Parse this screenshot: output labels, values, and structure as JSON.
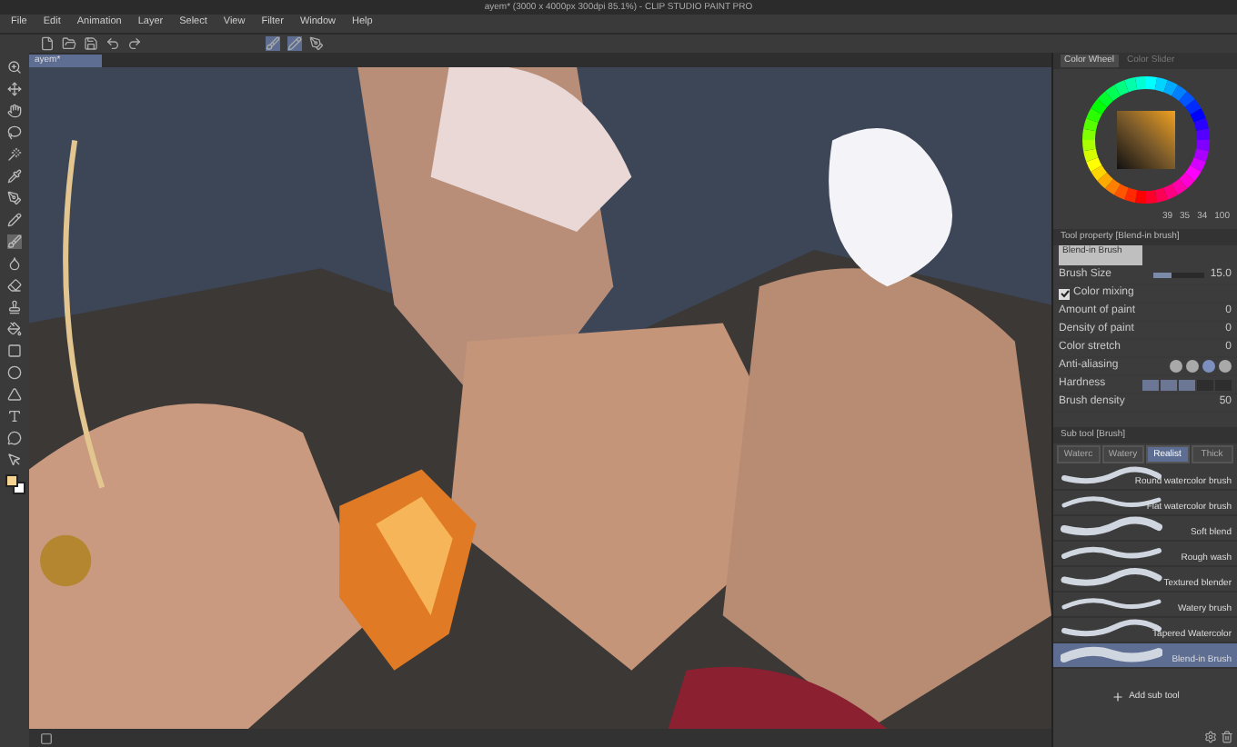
{
  "window": {
    "title": "ayem* (3000 x 4000px 300dpi 85.1%) - CLIP STUDIO PAINT PRO"
  },
  "menu": [
    "File",
    "Edit",
    "Animation",
    "Layer",
    "Select",
    "View",
    "Filter",
    "Window",
    "Help"
  ],
  "document_tabs": [
    {
      "label": "ayem*",
      "selected": true
    }
  ],
  "color_panel": {
    "tabs": [
      {
        "label": "Color Wheel",
        "selected": true
      },
      {
        "label": "Color Slider",
        "selected": false
      }
    ],
    "swatches": [
      {
        "color": "#f7d391"
      },
      {
        "color": "#ffffff"
      }
    ],
    "values": [
      "39",
      "35",
      "34",
      "100"
    ]
  },
  "tool_property": {
    "title": "Tool property [Blend-in brush]",
    "preview": "Blend-in Brush",
    "properties": [
      {
        "kind": "slider",
        "label": "Brush Size",
        "value": "15.0",
        "level": 0.35
      },
      {
        "kind": "checkbox",
        "label": "Color mixing",
        "checked": true
      },
      {
        "kind": "value",
        "label": "Amount of paint",
        "value": "0"
      },
      {
        "kind": "value",
        "label": "Density of paint",
        "value": "0"
      },
      {
        "kind": "value",
        "label": "Color stretch",
        "value": "0"
      },
      {
        "kind": "options",
        "label": "Anti-aliasing",
        "options": [
          {
            "selected": false
          },
          {
            "selected": false
          },
          {
            "selected": true
          },
          {
            "selected": false
          }
        ]
      },
      {
        "kind": "segments",
        "label": "Hardness",
        "level": 0.6
      },
      {
        "kind": "value",
        "label": "Brush density",
        "value": "50"
      }
    ]
  },
  "sub_tool": {
    "title": "Sub tool [Brush]",
    "tabs": [
      {
        "label": "Waterc",
        "selected": false
      },
      {
        "label": "Watery",
        "selected": false
      },
      {
        "label": "Realist",
        "selected": true
      },
      {
        "label": "Thick",
        "selected": false
      }
    ],
    "items": [
      {
        "label": "Round watercolor brush",
        "selected": false
      },
      {
        "label": "Flat watercolor brush",
        "selected": false
      },
      {
        "label": "Soft blend",
        "selected": false
      },
      {
        "label": "Rough wash",
        "selected": false
      },
      {
        "label": "Textured blender",
        "selected": false
      },
      {
        "label": "Watery brush",
        "selected": false
      },
      {
        "label": "Tapered Watercolor",
        "selected": false
      },
      {
        "label": "Blend-in Brush",
        "selected": true
      }
    ],
    "add_label": "Add sub tool"
  }
}
